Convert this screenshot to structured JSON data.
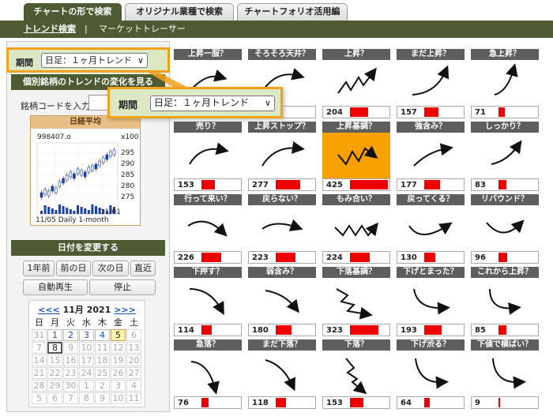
{
  "tabs": [
    {
      "label": "チャートの形で検索",
      "active": true
    },
    {
      "label": "オリジナル業種で検索",
      "active": false
    },
    {
      "label": "チャートフォリオ活用編",
      "active": false
    }
  ],
  "subnav": {
    "item1": "トレンド検索",
    "separator": "|",
    "item2": "マーケットトレーサー"
  },
  "period": {
    "label": "期間",
    "value": "日足：１ヶ月トレンド",
    "arrow": "∨"
  },
  "trend_section": {
    "title": "個別銘柄のトレンドの変化を見る",
    "code_label": "銘柄コードを入力"
  },
  "mini_chart": {
    "title": "日経平均",
    "value_label": "998407.o",
    "scale_label": "x100",
    "yticks": [
      "295",
      "290",
      "285",
      "280",
      "275"
    ],
    "date_label": "11/01",
    "footer": "11/05 Daily 1-month"
  },
  "date_section": {
    "title": "日付を変更する",
    "buttons": [
      "1年前",
      "前の日",
      "次の日",
      "直近"
    ],
    "buttons2": [
      "自動再生",
      "停止"
    ]
  },
  "calendar": {
    "prev": "<<<",
    "month": "11月 2021",
    "next": ">>>",
    "weekdays": [
      "日",
      "月",
      "火",
      "水",
      "木",
      "金",
      "土"
    ],
    "rows": [
      [
        "31",
        "1",
        "2",
        "3",
        "4",
        "5",
        "6"
      ],
      [
        "7",
        "8",
        "9",
        "10",
        "11",
        "12",
        "13"
      ],
      [
        "14",
        "15",
        "16",
        "17",
        "18",
        "19",
        "20"
      ],
      [
        "21",
        "22",
        "23",
        "24",
        "25",
        "26",
        "27"
      ],
      [
        "28",
        "29",
        "30",
        "1",
        "2",
        "3",
        "4"
      ],
      [
        "5",
        "6",
        "7",
        "8",
        "9",
        "10",
        "11"
      ]
    ]
  },
  "patterns": [
    {
      "label": "上昇一服？",
      "count": "",
      "bar": 0
    },
    {
      "label": "そろそろ天井？",
      "count": "",
      "bar": 0
    },
    {
      "label": "上昇？",
      "count": "204",
      "bar": 0.45
    },
    {
      "label": "まだ上昇？",
      "count": "157",
      "bar": 0.35
    },
    {
      "label": "急上昇？",
      "count": "71",
      "bar": 0.16
    },
    {
      "label": "売り？",
      "count": "153",
      "bar": 0.34
    },
    {
      "label": "上昇ストップ？",
      "count": "277",
      "bar": 0.62
    },
    {
      "label": "上昇基調？",
      "count": "425",
      "bar": 0.95
    },
    {
      "label": "強含み？",
      "count": "177",
      "bar": 0.4
    },
    {
      "label": "しっかり？",
      "count": "83",
      "bar": 0.19
    },
    {
      "label": "行って来い？",
      "count": "226",
      "bar": 0.5
    },
    {
      "label": "戻らない？",
      "count": "223",
      "bar": 0.5
    },
    {
      "label": "もみ合い？",
      "count": "224",
      "bar": 0.5
    },
    {
      "label": "戻ってくる？",
      "count": "130",
      "bar": 0.29
    },
    {
      "label": "リバウンド？",
      "count": "96",
      "bar": 0.21
    },
    {
      "label": "下押す？",
      "count": "114",
      "bar": 0.25
    },
    {
      "label": "弱含み？",
      "count": "180",
      "bar": 0.4
    },
    {
      "label": "下落基調？",
      "count": "323",
      "bar": 0.72
    },
    {
      "label": "下げとまった？",
      "count": "193",
      "bar": 0.43
    },
    {
      "label": "これから上昇？",
      "count": "85",
      "bar": 0.19
    },
    {
      "label": "急落？",
      "count": "76",
      "bar": 0.17
    },
    {
      "label": "まだ下落？",
      "count": "118",
      "bar": 0.26
    },
    {
      "label": "下落？",
      "count": "153",
      "bar": 0.34
    },
    {
      "label": "下げ渋る？",
      "count": "64",
      "bar": 0.14
    },
    {
      "label": "下値で横ばい？",
      "count": "9",
      "bar": 0.03
    }
  ],
  "callout": {
    "label": "期間",
    "value": "日足：１ヶ月トレンド",
    "arrow": "∨"
  }
}
